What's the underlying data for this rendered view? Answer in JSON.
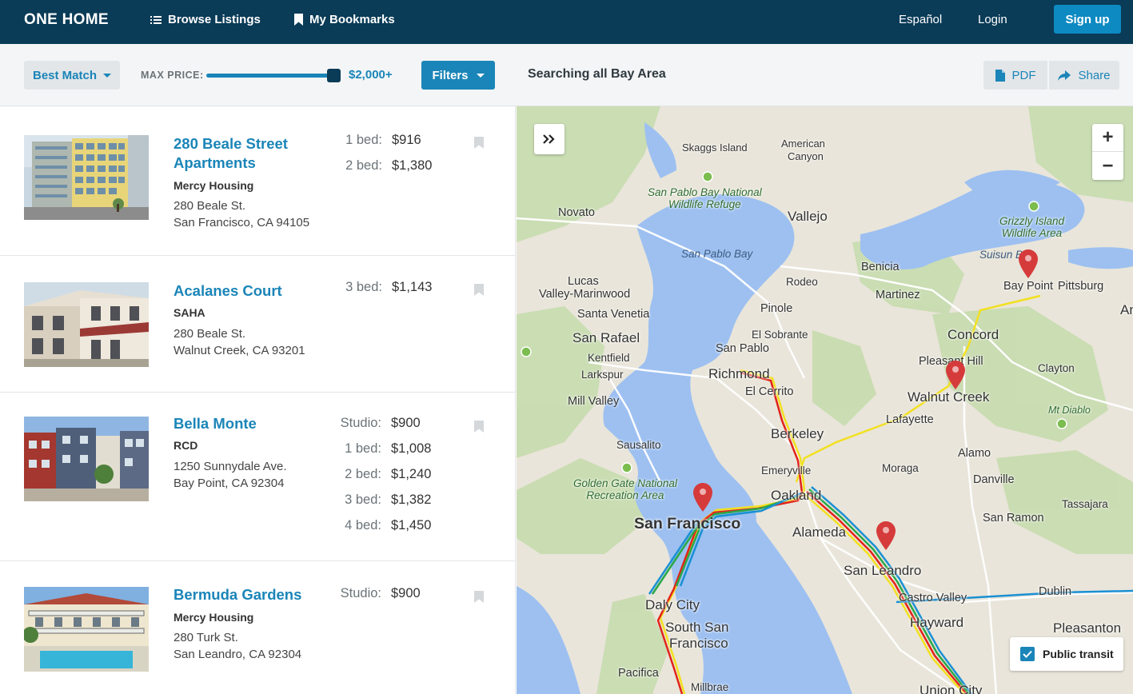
{
  "nav": {
    "brand": "ONE HOME",
    "browse_label": "Browse Listings",
    "bookmarks_label": "My Bookmarks",
    "language_label": "Español",
    "login_label": "Login",
    "signup_label": "Sign up"
  },
  "toolbar": {
    "sort_label": "Best Match",
    "max_price_label": "MAX PRICE:",
    "max_price_value": "$2,000+",
    "max_price_fraction": 1.0,
    "filters_label": "Filters",
    "search_status": "Searching all Bay Area",
    "pdf_label": "PDF",
    "share_label": "Share"
  },
  "listings": [
    {
      "name_line1": "280 Beale Street",
      "name_line2": "Apartments",
      "manager": "Mercy Housing",
      "address_line1": "280 Beale St.",
      "address_line2": "San Francisco, CA 94105",
      "prices": [
        {
          "unit": "1 bed:",
          "price": "$916"
        },
        {
          "unit": "2 bed:",
          "price": "$1,380"
        }
      ]
    },
    {
      "name_line1": "Acalanes Court",
      "manager": "SAHA",
      "address_line1": "280 Beale St.",
      "address_line2": "Walnut Creek, CA 93201",
      "prices": [
        {
          "unit": "3 bed:",
          "price": "$1,143"
        }
      ]
    },
    {
      "name_line1": "Bella Monte",
      "manager": "RCD",
      "address_line1": "1250 Sunnydale Ave.",
      "address_line2": "Bay Point, CA 92304",
      "prices": [
        {
          "unit": "Studio:",
          "price": "$900"
        },
        {
          "unit": "1 bed:",
          "price": "$1,008"
        },
        {
          "unit": "2 bed:",
          "price": "$1,240"
        },
        {
          "unit": "3 bed:",
          "price": "$1,382"
        },
        {
          "unit": "4 bed:",
          "price": "$1,450"
        }
      ]
    },
    {
      "name_line1": "Bermuda Gardens",
      "manager": "Mercy Housing",
      "address_line1": "280 Turk St.",
      "address_line2": "San Leandro, CA 92304",
      "prices": [
        {
          "unit": "Studio:",
          "price": "$900"
        }
      ]
    }
  ],
  "map": {
    "labels": {
      "skaggs": "Skaggs Island",
      "american_canyon_1": "American",
      "american_canyon_2": "Canyon",
      "san_pablo_refuge_1": "San Pablo Bay National",
      "san_pablo_refuge_2": "Wildlife Refuge",
      "novato": "Novato",
      "vallejo": "Vallejo",
      "grizzly_1": "Grizzly Island",
      "grizzly_2": "Wildlife Area",
      "san_pablo_bay": "San Pablo Bay",
      "suisun_bay": "Suisun Bay",
      "benicia": "Benicia",
      "lucas_1": "Lucas",
      "lucas_2": "Valley-Marinwood",
      "rodeo": "Rodeo",
      "bay_point": "Bay Point",
      "pittsburg": "Pittsburg",
      "an": "An",
      "martinez": "Martinez",
      "santa_venetia": "Santa Venetia",
      "pinole": "Pinole",
      "san_rafael": "San Rafael",
      "el_sobrante": "El Sobrante",
      "concord": "Concord",
      "kentfield": "Kentfield",
      "san_pablo": "San Pablo",
      "pleasant_hill": "Pleasant Hill",
      "larkspur": "Larkspur",
      "richmond": "Richmond",
      "clayton": "Clayton",
      "el_cerrito": "El Cerrito",
      "walnut_creek": "Walnut Creek",
      "mill_valley": "Mill Valley",
      "mt_diablo": "Mt Diablo",
      "lafayette": "Lafayette",
      "berkeley": "Berkeley",
      "sausalito": "Sausalito",
      "alamo": "Alamo",
      "moraga": "Moraga",
      "emeryville": "Emeryville",
      "golden_gate_1": "Golden Gate National",
      "golden_gate_2": "Recreation Area",
      "danville": "Danville",
      "oakland": "Oakland",
      "tassajara": "Tassajara",
      "san_francisco": "San Francisco",
      "san_ramon": "San Ramon",
      "alameda": "Alameda",
      "san_leandro": "San Leandro",
      "dublin": "Dublin",
      "castro_valley": "Castro Valley",
      "daly_city": "Daly City",
      "hayward": "Hayward",
      "south_sf_1": "South San",
      "south_sf_2": "Francisco",
      "pleasanton": "Pleasanton",
      "pacifica": "Pacifica",
      "millbrae": "Millbrae",
      "union_city": "Union City"
    },
    "zoom_in_label": "+",
    "zoom_out_label": "−",
    "transit_label": "Public transit",
    "transit_checked": true
  }
}
